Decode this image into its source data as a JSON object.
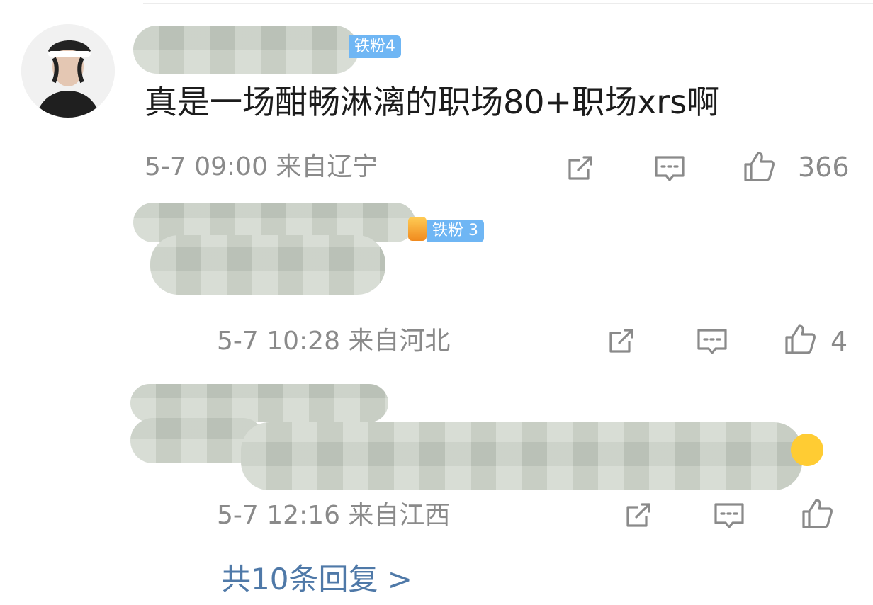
{
  "comment_1": {
    "badge": "铁粉4",
    "text": "真是一场酣畅淋漓的职场80+职场xrs啊",
    "meta": "5-7 09:00 来自辽宁",
    "likes": "366"
  },
  "reply_1": {
    "badge": "铁粉 3",
    "meta": "5-7 10:28 来自河北",
    "likes": "4"
  },
  "reply_2": {
    "meta": "5-7 12:16 来自江西"
  },
  "replies_link": "共10条回复 >"
}
